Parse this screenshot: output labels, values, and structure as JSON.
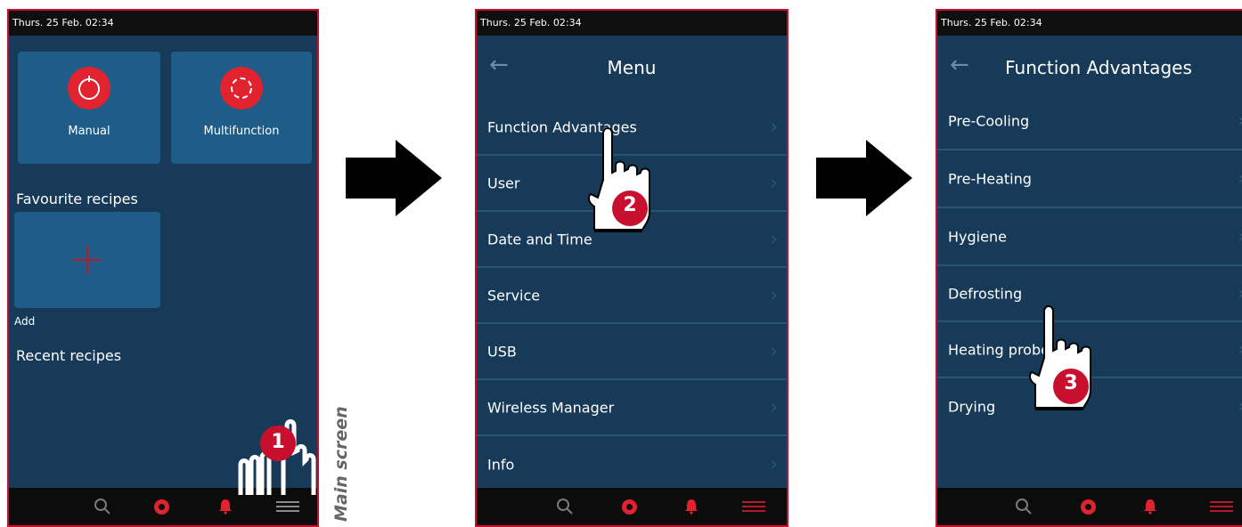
{
  "colors": {
    "accent": "#e1222f",
    "screen_bg": "#163a57",
    "tile_bg": "#1f5c87",
    "border": "#c8102e"
  },
  "screen1": {
    "status": "Thurs. 25 Feb. 02:34",
    "tiles": [
      {
        "label": "Manual",
        "icon": "power-icon"
      },
      {
        "label": "Multifunction",
        "icon": "multifunction-icon"
      }
    ],
    "favourites_label": "Favourite recipes",
    "add_label": "Add",
    "recent_label": "Recent recipes",
    "step": "1",
    "caption": "Main screen"
  },
  "screen2": {
    "status": "Thurs. 25 Feb. 02:34",
    "title": "Menu",
    "items": [
      "Function Advantages",
      "User",
      "Date and Time",
      "Service",
      "USB",
      "Wireless Manager",
      "Info"
    ],
    "step": "2"
  },
  "screen3": {
    "status": "Thurs. 25 Feb. 02:34",
    "title": "Function Advantages",
    "items": [
      "Pre-Cooling",
      "Pre-Heating",
      "Hygiene",
      "Defrosting",
      "Heating probe",
      "Drying"
    ],
    "step": "3"
  },
  "bottom_bar": {
    "icons": [
      "search-icon",
      "home-ring-icon",
      "bell-icon",
      "menu-icon"
    ]
  }
}
